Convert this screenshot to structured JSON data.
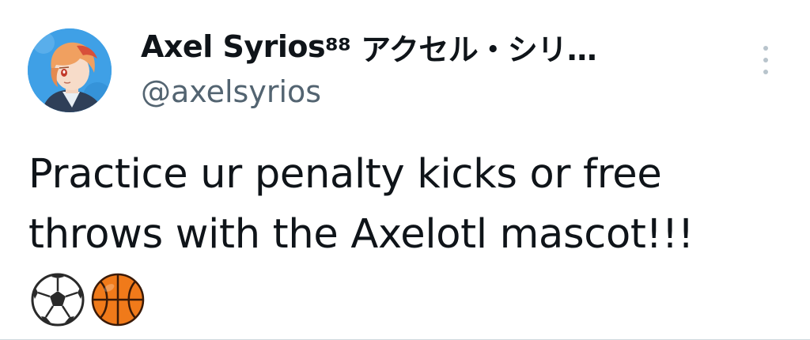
{
  "author": {
    "display_name": "Axel Syrios",
    "name_suffix": "⁸⁸ アクセル・シリ…",
    "handle": "@axelsyrios",
    "avatar_icon": "anime-character-avatar"
  },
  "tweet": {
    "text_line_1": "Practice ur penalty kicks or free",
    "text_line_2": "throws with the Axelotl mascot!!!",
    "emojis": [
      "soccer-ball-icon",
      "basketball-icon"
    ]
  },
  "colors": {
    "text": "#0f1419",
    "secondary": "#536471",
    "more_dots": "#b8c4cc",
    "avatar_bg": "#3fa0e6",
    "basketball": "#f07a1a"
  }
}
